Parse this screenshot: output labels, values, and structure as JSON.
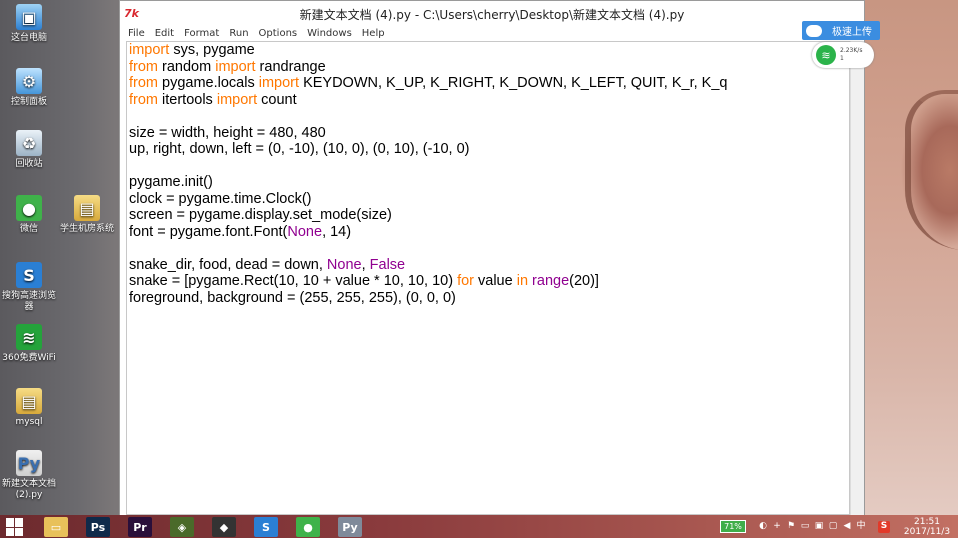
{
  "window": {
    "logo": "7k",
    "title": "新建文本文档 (4).py - C:\\Users\\cherry\\Desktop\\新建文本文档 (4).py"
  },
  "menu": [
    "File",
    "Edit",
    "Format",
    "Run",
    "Options",
    "Windows",
    "Help"
  ],
  "code_lines": [
    [
      {
        "t": "import",
        "c": "kw"
      },
      {
        "t": " sys, pygame"
      }
    ],
    [
      {
        "t": "from",
        "c": "kw"
      },
      {
        "t": " random "
      },
      {
        "t": "import",
        "c": "kw"
      },
      {
        "t": " randrange"
      }
    ],
    [
      {
        "t": "from",
        "c": "kw"
      },
      {
        "t": " pygame.locals "
      },
      {
        "t": "import",
        "c": "kw"
      },
      {
        "t": " KEYDOWN, K_UP, K_RIGHT, K_DOWN, K_LEFT, QUIT, K_r, K_q"
      }
    ],
    [
      {
        "t": "from",
        "c": "kw"
      },
      {
        "t": " itertools "
      },
      {
        "t": "import",
        "c": "kw"
      },
      {
        "t": " count"
      }
    ],
    [],
    [
      {
        "t": "size = width, height = 480, 480"
      }
    ],
    [
      {
        "t": "up, right, down, left = (0, -10), (10, 0), (0, 10), (-10, 0)"
      }
    ],
    [],
    [
      {
        "t": "pygame.init()"
      }
    ],
    [
      {
        "t": "clock = pygame.time.Clock()"
      }
    ],
    [
      {
        "t": "screen = pygame.display.set_mode(size)"
      }
    ],
    [
      {
        "t": "font = pygame.font.Font("
      },
      {
        "t": "None",
        "c": "bi"
      },
      {
        "t": ", 14)"
      }
    ],
    [],
    [
      {
        "t": "snake_dir, food, dead = down, "
      },
      {
        "t": "None",
        "c": "bi"
      },
      {
        "t": ", "
      },
      {
        "t": "False",
        "c": "bi"
      }
    ],
    [
      {
        "t": "snake = [pygame.Rect(10, 10 + value * 10, 10, 10) "
      },
      {
        "t": "for",
        "c": "kw"
      },
      {
        "t": " value "
      },
      {
        "t": "in",
        "c": "kw"
      },
      {
        "t": " "
      },
      {
        "t": "range",
        "c": "bi"
      },
      {
        "t": "(20)]"
      }
    ],
    [
      {
        "t": "foreground, background = (255, 255, 255), (0, 0, 0)"
      }
    ]
  ],
  "desktop_icons": [
    {
      "label": "这台电脑",
      "icon": "computer-icon",
      "glyph": "▣"
    },
    {
      "label": "控制面板",
      "icon": "control-panel-icon",
      "glyph": "⚙"
    },
    {
      "label": "回收站",
      "icon": "recycle-bin-icon",
      "glyph": "♻"
    },
    {
      "label": "微信",
      "icon": "wechat-icon",
      "glyph": "●"
    },
    {
      "label": "学生机房系统",
      "icon": "folder-icon",
      "glyph": "▤"
    },
    {
      "label": "搜狗高速浏览器",
      "icon": "sogou-browser-icon",
      "glyph": "S"
    },
    {
      "label": "360免费WiFi",
      "icon": "wifi-icon",
      "glyph": "≋"
    },
    {
      "label": "mysql",
      "icon": "folder-icon",
      "glyph": "▤"
    },
    {
      "label": "新建文本文档 (2).py",
      "icon": "python-file-icon",
      "glyph": "Py"
    }
  ],
  "upload_widget": {
    "label": "极速上传",
    "speed": "2.23K/s",
    "count": "1"
  },
  "taskbar": {
    "apps": [
      {
        "name": "file-explorer-icon",
        "glyph": "▭",
        "color": "#e8c15a"
      },
      {
        "name": "photoshop-icon",
        "glyph": "Ps",
        "color": "#0f2a4a"
      },
      {
        "name": "premiere-icon",
        "glyph": "Pr",
        "color": "#2a0f3a"
      },
      {
        "name": "app-icon",
        "glyph": "◈",
        "color": "#4a6a2a"
      },
      {
        "name": "unity-icon",
        "glyph": "◆",
        "color": "#333333"
      },
      {
        "name": "sogou-icon",
        "glyph": "S",
        "color": "#2a7fd4"
      },
      {
        "name": "wechat-icon",
        "glyph": "●",
        "color": "#3fb24a"
      },
      {
        "name": "python-idle-icon",
        "glyph": "Py",
        "color": "#7f8a9a"
      }
    ],
    "battery": "71%",
    "time": "21:51",
    "date": "2017/11/3",
    "ime": "中"
  }
}
